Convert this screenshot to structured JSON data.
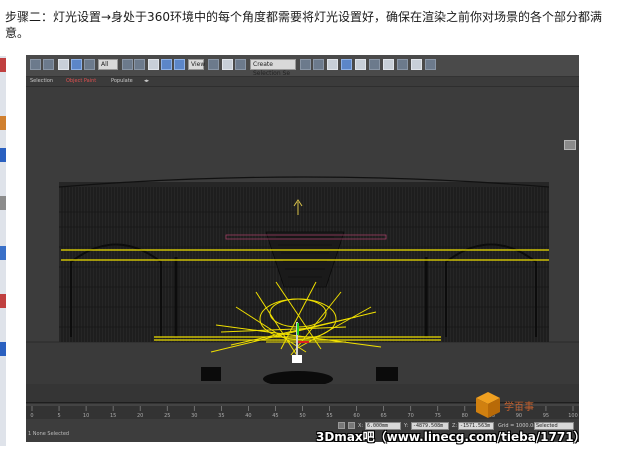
{
  "article": {
    "text": "步骤二：灯光设置→身处于360环境中的每个角度都需要将灯光设置好，确保在渲染之前你对场景的各个部分都满意。"
  },
  "toolbar": {
    "selection_filter": "All",
    "view_dropdown": "View",
    "named_selection": "Create Selection Se"
  },
  "ribbon": {
    "tab_selection": "Selection",
    "tab_object_paint": "Object Paint",
    "tab_populate": "Populate"
  },
  "timeslider": {
    "ticks": [
      "0",
      "5",
      "10",
      "15",
      "20",
      "25",
      "30",
      "35",
      "40",
      "45",
      "50",
      "55",
      "60",
      "65",
      "70",
      "75",
      "80",
      "85",
      "90",
      "95",
      "100"
    ]
  },
  "statusbar": {
    "prompt": "1 None Selected",
    "hint": "Click or click-and-drag to select objects",
    "x_label": "X:",
    "x_value": "6.000mm",
    "y_label": "Y:",
    "y_value": "-4879.508m",
    "z_label": "Z:",
    "z_value": "-1571.563m",
    "grid": "Grid = 1000.0mm",
    "autokey": "Auto Key",
    "setkey_dropdown": "Selected"
  },
  "watermark": {
    "text": "3Dmax吧（www.linecg.com/tieba/1771）",
    "logo_text": "学百事"
  },
  "colors": {
    "viewport_bg": "#3c3c3c",
    "light_yellow": "#f0e000",
    "wireframe": "#141414"
  }
}
